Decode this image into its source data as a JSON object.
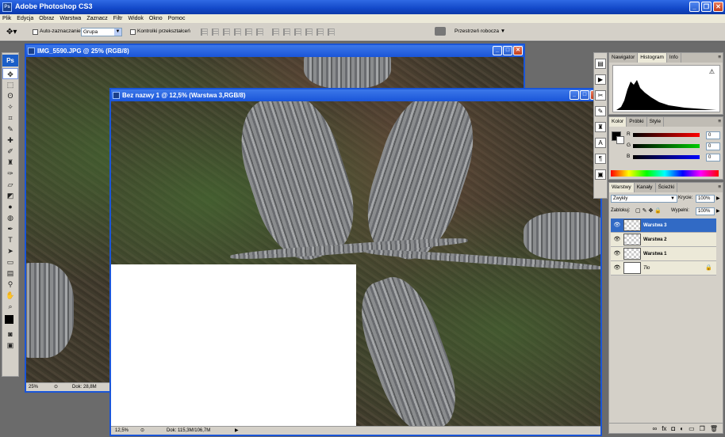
{
  "app": {
    "title": "Adobe Photoshop CS3",
    "logo": "Ps"
  },
  "menu": [
    "Plik",
    "Edycja",
    "Obraz",
    "Warstwa",
    "Zaznacz",
    "Filtr",
    "Widok",
    "Okno",
    "Pomoc"
  ],
  "options": {
    "auto_select_label": "Auto-zaznaczanie:",
    "auto_select_value": "Grupa",
    "transform_label": "Kontrolki przekształceń",
    "workspace_label": "Przestrzeń robocza"
  },
  "doc1": {
    "title": "IMG_5590.JPG @ 25% (RGB/8)",
    "zoom": "25%",
    "doc_size": "Dok: 28,8M"
  },
  "doc2": {
    "title": "Bez nazwy 1 @ 12,5% (Warstwa 3,RGB/8)",
    "zoom": "12,5%",
    "doc_size": "Dok: 115,3M/106,7M"
  },
  "histogram_panel": {
    "tabs": [
      "Nawigator",
      "Histogram",
      "Info"
    ],
    "active": "Histogram"
  },
  "color_panel": {
    "tabs": [
      "Kolor",
      "Próbki",
      "Style"
    ],
    "channels": [
      {
        "label": "R",
        "value": "0",
        "color": "#e02020"
      },
      {
        "label": "G",
        "value": "0",
        "color": "#20a020"
      },
      {
        "label": "B",
        "value": "0",
        "color": "#2020c0"
      }
    ],
    "foreground": "#000000"
  },
  "layers_panel": {
    "tabs": [
      "Warstwy",
      "Kanały",
      "Ścieżki"
    ],
    "blend_mode": "Zwykły",
    "opacity_label": "Krycie:",
    "opacity_value": "100%",
    "lock_label": "Zablokuj:",
    "fill_label": "Wypełni:",
    "fill_value": "100%",
    "layers": [
      {
        "name": "Warstwa 3",
        "selected": true
      },
      {
        "name": "Warstwa 2",
        "selected": false
      },
      {
        "name": "Warstwa 1",
        "selected": false
      },
      {
        "name": "Tło",
        "selected": false
      }
    ]
  }
}
